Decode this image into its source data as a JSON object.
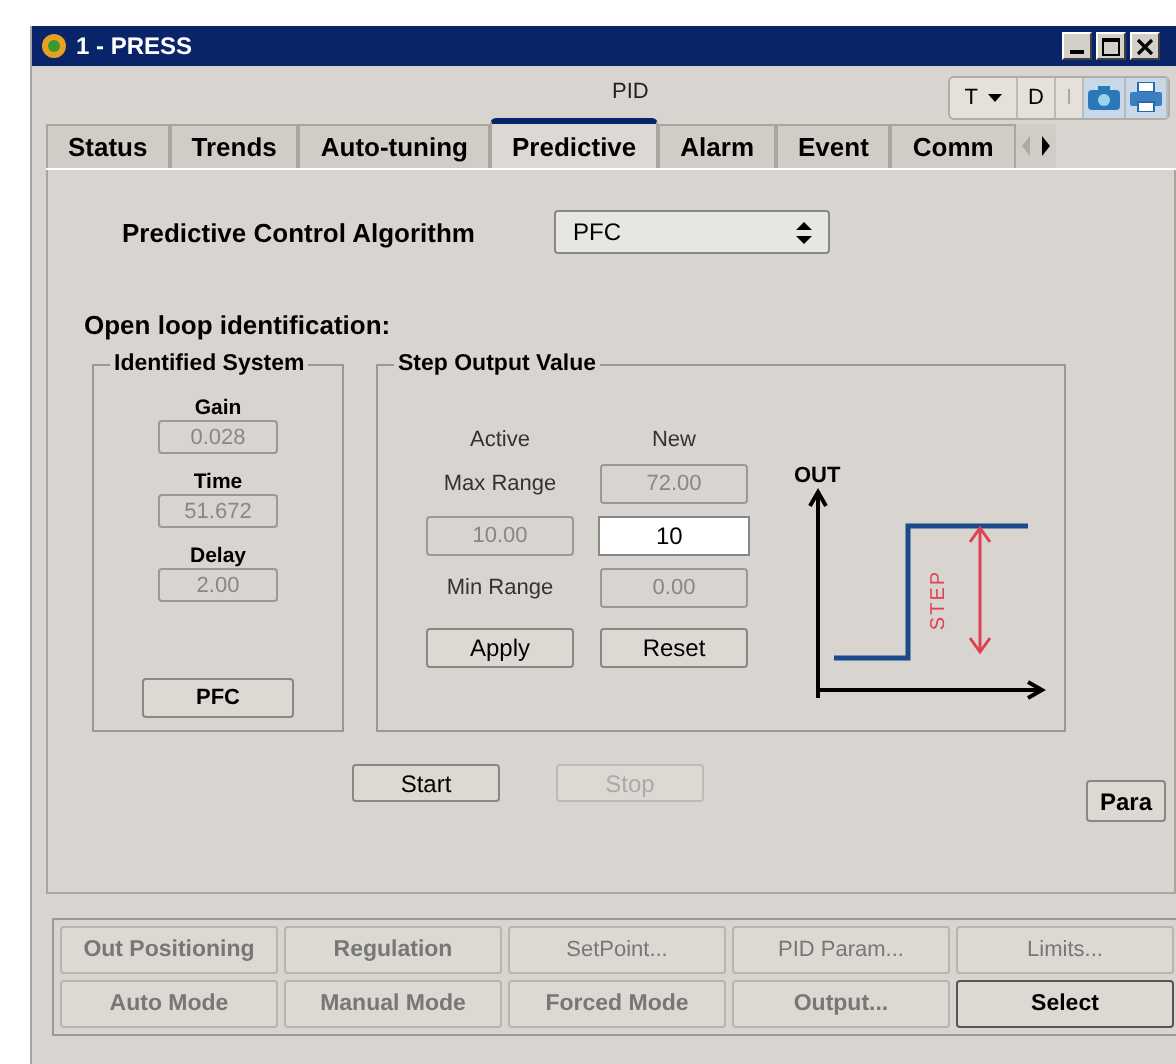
{
  "window": {
    "title": "1 - PRESS"
  },
  "header": {
    "label": "PID",
    "toolbar": [
      {
        "kind": "dropdown",
        "label": "T"
      },
      {
        "kind": "text",
        "label": "D",
        "disabled": false
      },
      {
        "kind": "text",
        "label": "I",
        "disabled": true
      },
      {
        "kind": "camera"
      },
      {
        "kind": "printer"
      }
    ]
  },
  "tabs": [
    {
      "label": "Status",
      "selected": false
    },
    {
      "label": "Trends",
      "selected": false
    },
    {
      "label": "Auto-tuning",
      "selected": false
    },
    {
      "label": "Predictive",
      "selected": true
    },
    {
      "label": "Alarm",
      "selected": false
    },
    {
      "label": "Event",
      "selected": false
    },
    {
      "label": "Comm",
      "selected": false
    }
  ],
  "algorithm": {
    "label": "Predictive Control Algorithm",
    "value": "PFC"
  },
  "section_title": "Open loop identification:",
  "identified_system": {
    "title": "Identified System",
    "fields": [
      {
        "label": "Gain",
        "value": "0.028"
      },
      {
        "label": "Time",
        "value": "51.672"
      },
      {
        "label": "Delay",
        "value": "2.00"
      }
    ],
    "button": "PFC"
  },
  "step_output": {
    "title": "Step Output Value",
    "active_header": "Active",
    "new_header": "New",
    "max_label": "Max Range",
    "max_new": "72.00",
    "step_active": "10.00",
    "step_new": "10",
    "min_label": "Min Range",
    "min_new": "0.00",
    "apply": "Apply",
    "reset": "Reset",
    "diagram": {
      "axis_label": "OUT",
      "step_label": "STEP"
    }
  },
  "actions": [
    {
      "label": "Start",
      "disabled": false
    },
    {
      "label": "Stop",
      "disabled": true
    }
  ],
  "para_button": "Para",
  "bottom_buttons": [
    {
      "label": "Out Positioning",
      "kind": "bold",
      "disabled": true
    },
    {
      "label": "Regulation",
      "kind": "bold",
      "disabled": true
    },
    {
      "label": "SetPoint...",
      "kind": "normal",
      "disabled": true
    },
    {
      "label": "PID Param...",
      "kind": "normal",
      "disabled": true
    },
    {
      "label": "Limits...",
      "kind": "normal",
      "disabled": true
    },
    {
      "label": "Auto Mode",
      "kind": "bold",
      "disabled": true
    },
    {
      "label": "Manual Mode",
      "kind": "bold",
      "disabled": true
    },
    {
      "label": "Forced Mode",
      "kind": "bold",
      "disabled": true
    },
    {
      "label": "Output...",
      "kind": "bold",
      "disabled": true
    },
    {
      "label": "Select",
      "kind": "bold",
      "disabled": false
    }
  ]
}
